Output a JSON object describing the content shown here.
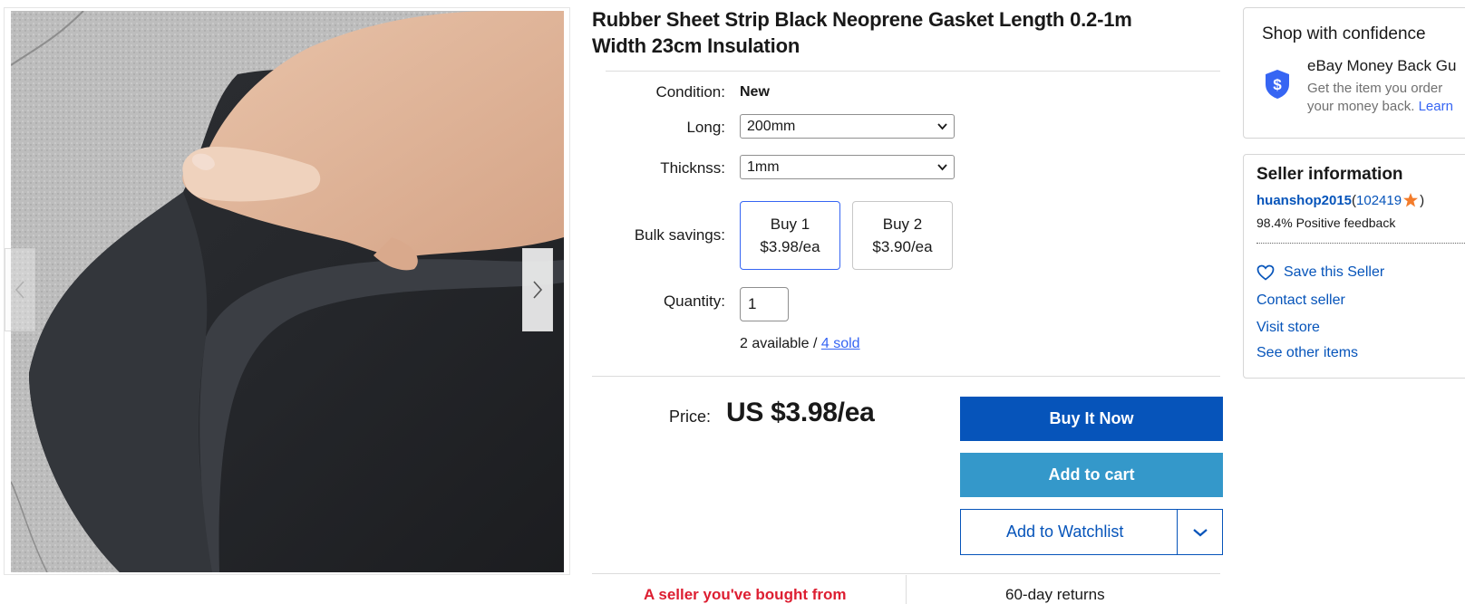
{
  "gallery": {
    "image_alt": "Black neoprene rubber sheet held by hand",
    "prev_icon": "chevron-left-icon",
    "next_icon": "chevron-right-icon"
  },
  "product": {
    "title_line1": "Rubber Sheet Strip Black Neoprene Gasket Length 0.2-1m",
    "title_line2": "Width 23cm Insulation"
  },
  "details": {
    "condition_label": "Condition:",
    "condition_value": "New",
    "long_label": "Long:",
    "long_value": "200mm",
    "thickness_label": "Thicknss:",
    "thickness_value": "1mm",
    "bulk_label": "Bulk savings:",
    "bulk_options": [
      {
        "line1": "Buy 1",
        "line2": "$3.98/ea"
      },
      {
        "line1": "Buy 2",
        "line2": "$3.90/ea"
      }
    ],
    "quantity_label": "Quantity:",
    "quantity_value": "1",
    "available_text": "2 available / ",
    "sold_text": "4 sold"
  },
  "pricing": {
    "price_label": "Price:",
    "price_value": "US $3.98/ea"
  },
  "actions": {
    "buy_now": "Buy It Now",
    "add_to_cart": "Add to cart",
    "add_to_watchlist": "Add to Watchlist"
  },
  "footer_strip": {
    "left_text": "A seller you've bought from",
    "right_text": "60-day returns"
  },
  "confidence": {
    "title": "Shop with confidence",
    "guarantee_title": "eBay Money Back Gu",
    "guarantee_line1": "Get the item you order",
    "guarantee_line2": "your money back. ",
    "learn_text": "Learn",
    "icon": "shield-dollar-icon"
  },
  "seller": {
    "title": "Seller information",
    "name": "huanshop2015",
    "score_open": " (",
    "score": "102419",
    "score_close": ")",
    "feedback": "98.4% Positive feedback",
    "save_seller": "Save this Seller",
    "contact": "Contact seller",
    "visit_store": "Visit store",
    "other_items": "See other items"
  },
  "colors": {
    "primary_blue": "#0654ba",
    "cart_blue": "#3498ca",
    "link_blue": "#3665f3",
    "alert_red": "#dd1e31",
    "star_orange": "#f37c2b"
  }
}
